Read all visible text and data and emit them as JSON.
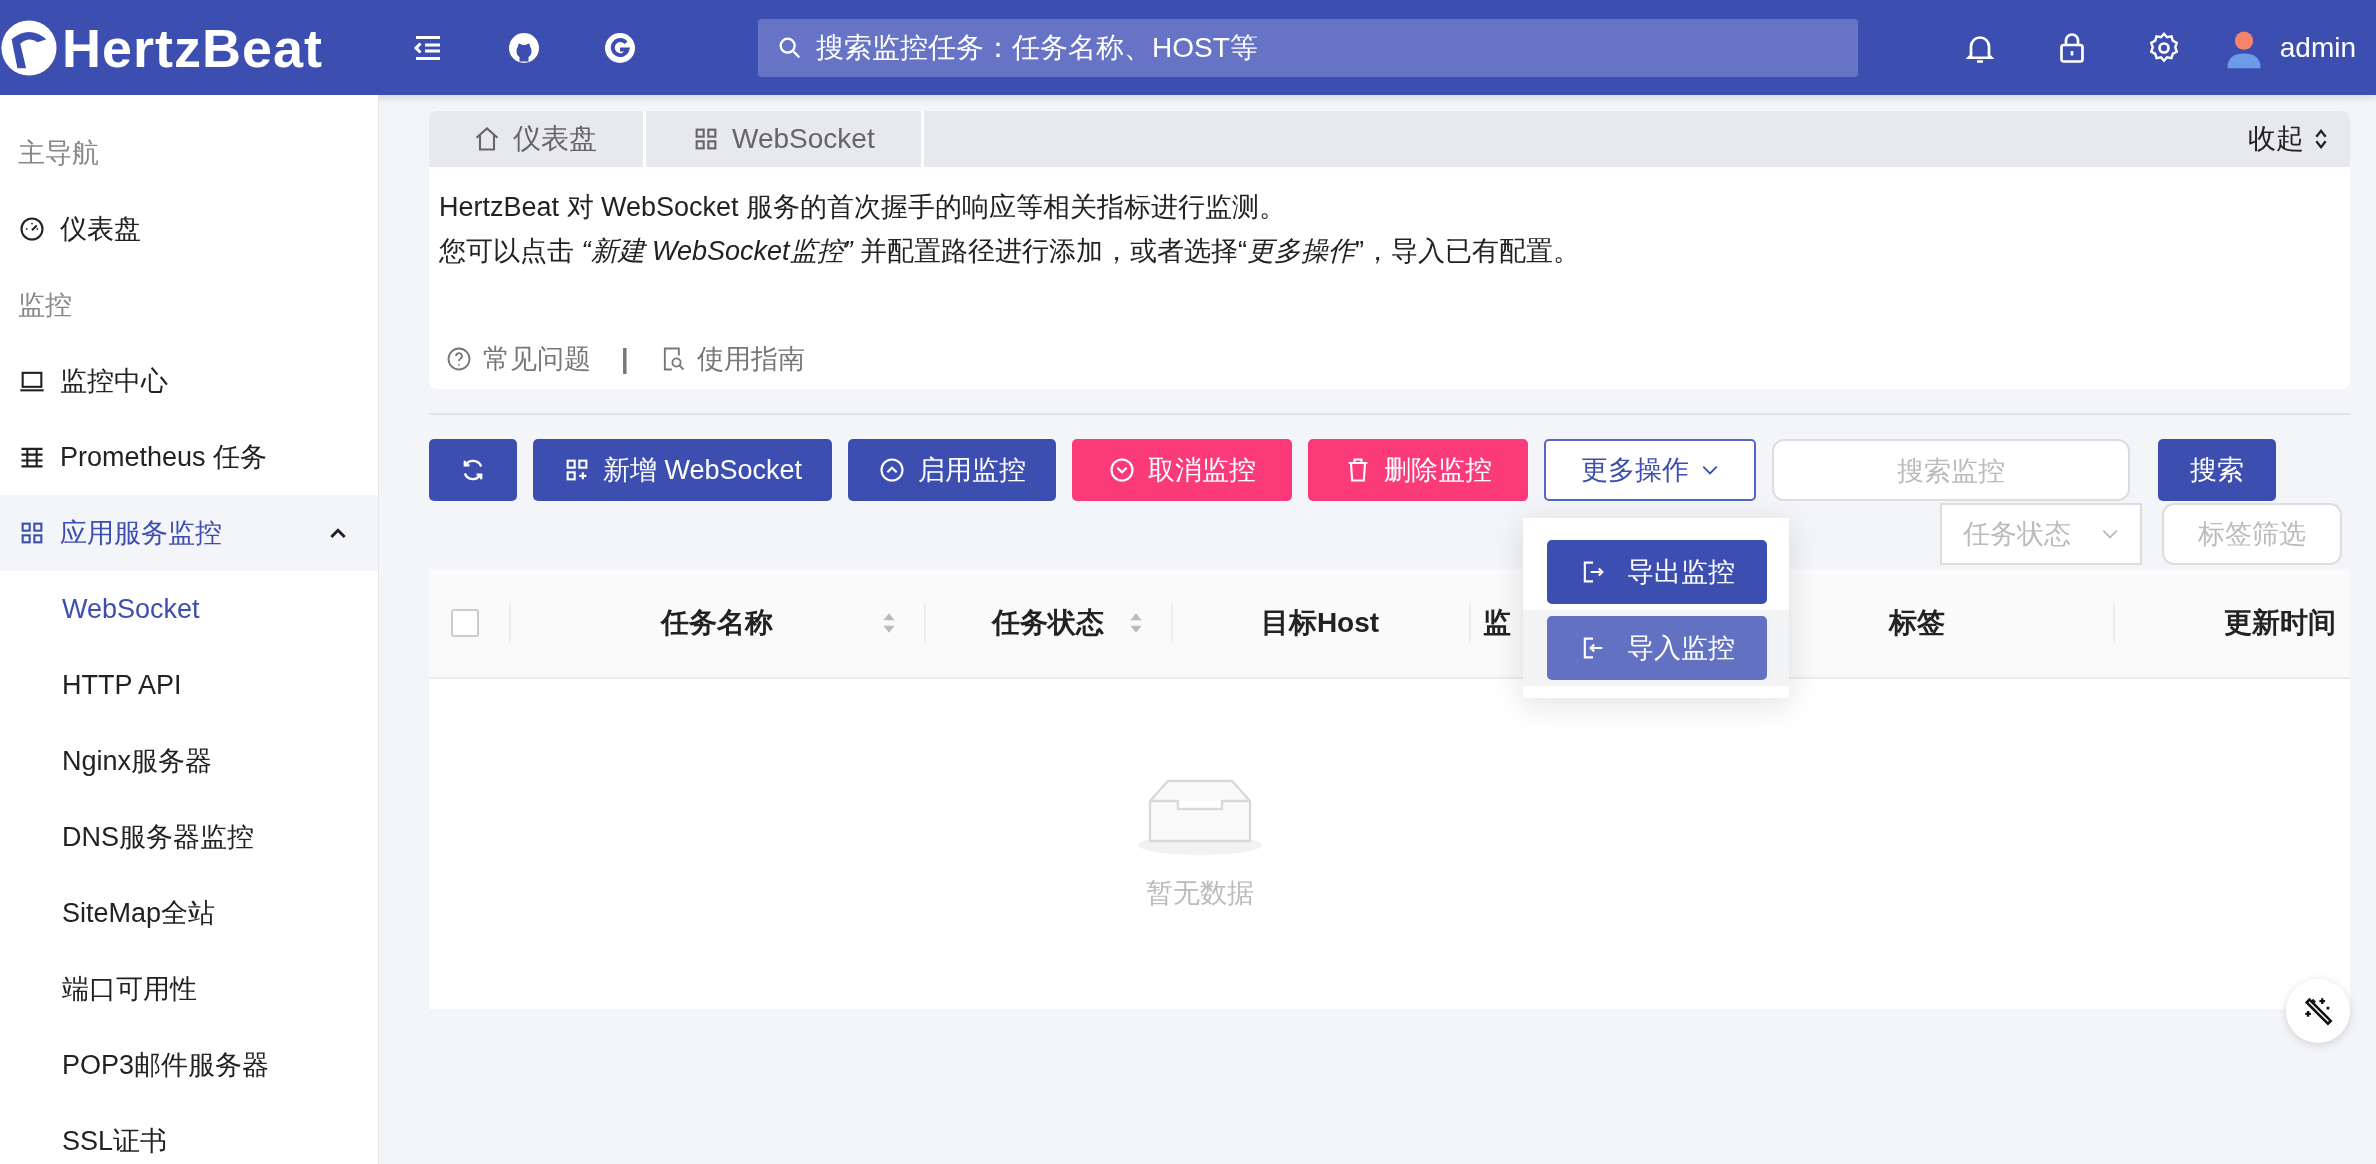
{
  "header": {
    "logo_text": "HertzBeat",
    "search": {
      "placeholder": "搜索监控任务：任务名称、HOST等"
    },
    "user": "admin"
  },
  "sidebar": {
    "items": [
      {
        "kind": "group",
        "label": "主导航"
      },
      {
        "kind": "link",
        "label": "仪表盘"
      },
      {
        "kind": "group",
        "label": "监控"
      },
      {
        "kind": "link",
        "label": "监控中心"
      },
      {
        "kind": "link",
        "label": "Prometheus 任务"
      },
      {
        "kind": "link",
        "label": "应用服务监控",
        "expanded": true,
        "children": [
          {
            "label": "WebSocket",
            "selected": true
          },
          {
            "label": "HTTP API",
            "selected": false
          },
          {
            "label": "Nginx服务器",
            "selected": false
          },
          {
            "label": "DNS服务器监控",
            "selected": false
          },
          {
            "label": "SiteMap全站",
            "selected": false
          },
          {
            "label": "端口可用性",
            "selected": false
          },
          {
            "label": "POP3邮件服务器",
            "selected": false
          },
          {
            "label": "SSL证书",
            "selected": false
          }
        ]
      }
    ]
  },
  "breadcrumb": [
    {
      "label": "仪表盘"
    },
    {
      "label": "WebSocket"
    }
  ],
  "collapse_label": "收起",
  "intro": {
    "lines": [
      "HertzBeat 对 WebSocket 服务的首次握手的响应等相关指标进行监测。",
      "您可以点击 *“新建 WebSocket监控”* 并配置路径进行添加，或者选择“*更多操作*”，导入已有配置。"
    ],
    "links": [
      {
        "label": "常见问题"
      },
      {
        "label": "使用指南"
      }
    ],
    "separator": "|"
  },
  "toolbar": {
    "buttons": [
      {
        "kind": "primary"
      },
      {
        "kind": "primary",
        "label": "新增 WebSocket"
      },
      {
        "kind": "primary",
        "label": "启用监控"
      },
      {
        "kind": "danger",
        "label": "取消监控"
      },
      {
        "kind": "danger",
        "label": "删除监控"
      },
      {
        "kind": "outline",
        "label": "更多操作"
      }
    ],
    "search": {
      "placeholder": "搜索监控"
    },
    "search_button": "搜索",
    "status_filter": {
      "placeholder": "任务状态"
    },
    "tag_filter": "标签筛选"
  },
  "dropdown": {
    "open": true,
    "items": [
      {
        "label": "导出监控",
        "highlighted": false
      },
      {
        "label": "导入监控",
        "highlighted": true
      }
    ]
  },
  "table": {
    "select_all": {
      "checked": false
    },
    "columns": [
      {
        "label": "任务名称",
        "sortable": true
      },
      {
        "label": "任务状态",
        "sortable": true
      },
      {
        "label": "目标Host",
        "sortable": false
      },
      {
        "label": "监"
      },
      {
        "label": "标签",
        "sortable": false
      },
      {
        "label": "更新时间",
        "sortable": false
      }
    ],
    "empty_text": "暂无数据"
  }
}
